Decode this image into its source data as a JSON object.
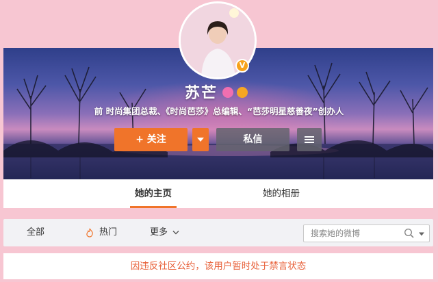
{
  "profile": {
    "name": "苏芒",
    "vip_mark": "V",
    "bio": "前 时尚集团总裁、《时尚芭莎》总编辑、“芭莎明星慈善夜”创办人"
  },
  "actions": {
    "follow_label": "+ 关注",
    "message_label": "私信"
  },
  "tabs": [
    {
      "label": "她的主页",
      "active": true
    },
    {
      "label": "她的相册",
      "active": false
    }
  ],
  "filters": {
    "all_label": "全部",
    "hot_label": "热门",
    "more_label": "更多",
    "search_placeholder": "搜索她的微博"
  },
  "notice": {
    "text": "因违反社区公约，该用户暂时处于禁言状态",
    "color": "#e8613a"
  },
  "colors": {
    "accent": "#f0742a",
    "background": "#f7c6d2"
  }
}
